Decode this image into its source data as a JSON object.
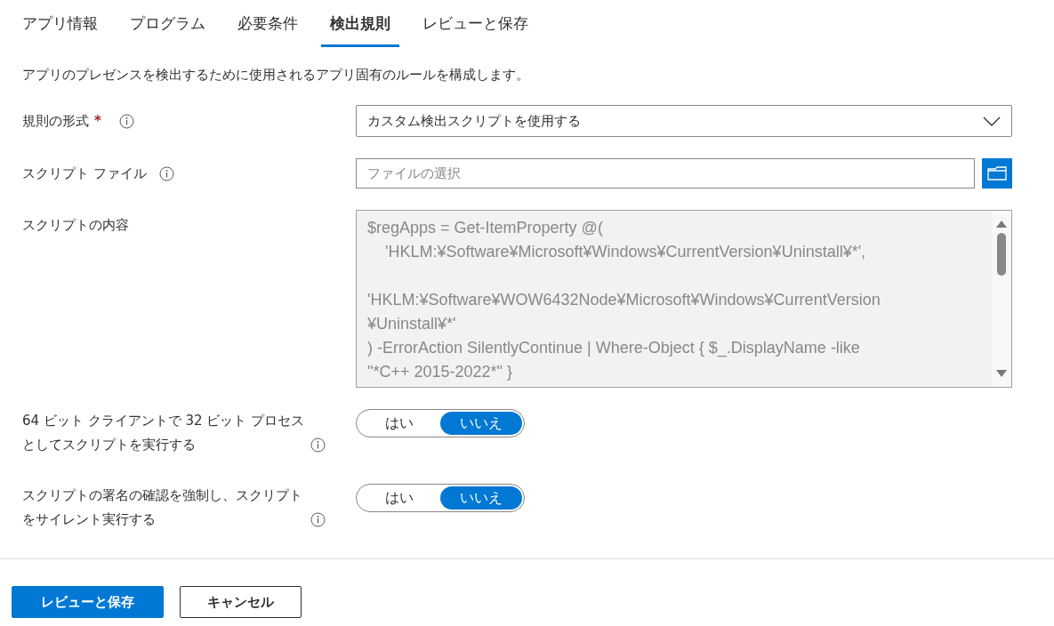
{
  "tabs": [
    {
      "label": "アプリ情報",
      "selected": false
    },
    {
      "label": "プログラム",
      "selected": false
    },
    {
      "label": "必要条件",
      "selected": false
    },
    {
      "label": "検出規則",
      "selected": true
    },
    {
      "label": "レビューと保存",
      "selected": false
    }
  ],
  "description": "アプリのプレゼンスを検出するために使用されるアプリ固有のルールを構成します。",
  "rule_format": {
    "label": "規則の形式",
    "required_mark": "*",
    "value": "カスタム検出スクリプトを使用する"
  },
  "script_file": {
    "label": "スクリプト ファイル",
    "placeholder": "ファイルの選択"
  },
  "script_content": {
    "label": "スクリプトの内容",
    "value": "$regApps = Get-ItemProperty @(\n    'HKLM:¥Software¥Microsoft¥Windows¥CurrentVersion¥Uninstall¥*',\n\n'HKLM:¥Software¥WOW6432Node¥Microsoft¥Windows¥CurrentVersion\n¥Uninstall¥*'\n) -ErrorAction SilentlyContinue | Where-Object { $_.DisplayName -like\n\"*C++ 2015-2022*\" }"
  },
  "toggles": [
    {
      "label": "64 ビット クライアントで 32 ビット プロセスとしてスクリプトを実行する",
      "options": [
        {
          "label": "はい",
          "selected": false
        },
        {
          "label": "いいえ",
          "selected": true
        }
      ]
    },
    {
      "label": "スクリプトの署名の確認を強制し、スクリプトをサイレント実行する",
      "options": [
        {
          "label": "はい",
          "selected": false
        },
        {
          "label": "いいえ",
          "selected": true
        }
      ]
    }
  ],
  "buttons": [
    {
      "label": "レビューと保存",
      "kind": "primary"
    },
    {
      "label": "キャンセル",
      "kind": "secondary"
    }
  ]
}
